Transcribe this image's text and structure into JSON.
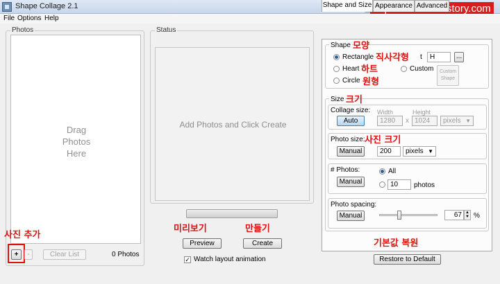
{
  "window": {
    "title": "Shape Collage 2.1",
    "min": "–",
    "max": "□",
    "close": "✕"
  },
  "watermark": "http://nextcom.tistory.com",
  "menu": {
    "file": "File",
    "options": "Options",
    "help": "Help"
  },
  "photos": {
    "group_label": "Photos",
    "drag_line1": "Drag",
    "drag_line2": "Photos",
    "drag_line3": "Here",
    "add_label": "+",
    "remove_label": "-",
    "clear_label": "Clear List",
    "count": "0 Photos"
  },
  "status": {
    "group_label": "Status",
    "message": "Add Photos and Click Create",
    "progress": 0,
    "preview_label": "Preview",
    "create_label": "Create",
    "watch_label": "Watch layout animation",
    "watch_checked": "✓"
  },
  "tabs": [
    "Shape and Size",
    "Appearance",
    "Advanced"
  ],
  "shape": {
    "title": "Shape",
    "rectangle": "Rectangle",
    "text_suffix": "t",
    "text_value": "H",
    "browse": "...",
    "heart": "Heart",
    "custom": "Custom",
    "custom_shape_line1": "Custom",
    "custom_shape_line2": "Shape",
    "circle": "Circle"
  },
  "size": {
    "title": "Size",
    "collage_size": "Collage size:",
    "width_label": "Width",
    "height_label": "Height",
    "auto": "Auto",
    "width": "1280",
    "times": "x",
    "height": "1024",
    "unit": "pixels",
    "photo_size": "Photo size:",
    "manual": "Manual",
    "photo_size_value": "200",
    "photo_unit": "pixels",
    "num_photos": "# Photos:",
    "all": "All",
    "num_value": "10",
    "photos_word": "photos",
    "spacing": "Photo spacing:",
    "spacing_value": "67",
    "percent": "%"
  },
  "restore_label": "Restore to Default",
  "annotations": {
    "shape": "모양",
    "rectangle": "직사각형",
    "heart": "하트",
    "circle": "원형",
    "size": "크기",
    "photo_size": "사진 크기",
    "preview": "미리보기",
    "create": "만들기",
    "add_photo": "사진 추가",
    "restore": "기본값 복원"
  },
  "colors": {
    "annotation": "#e01010",
    "watermark_bg": "#d91d1d"
  }
}
